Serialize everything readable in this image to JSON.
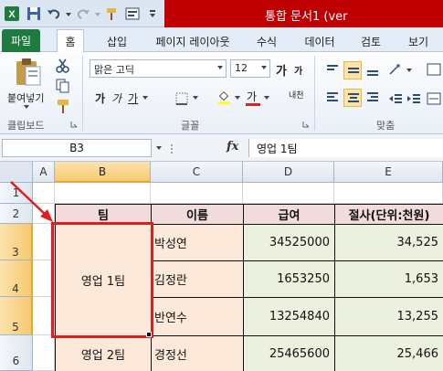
{
  "title": "통합 문서1 (ver",
  "tabs": [
    "파일",
    "홈",
    "삽입",
    "페이지 레이아웃",
    "수식",
    "데이터",
    "검토",
    "보기"
  ],
  "ribbon": {
    "paste_label": "붙여넣기",
    "clipboard_label": "클립보드",
    "font_name": "맑은 고딕",
    "font_size": "12",
    "font_group_label": "글꼴",
    "align_group_label": "맞춤",
    "bold": "가",
    "italic": "가",
    "underline": "가",
    "grow_font": "가",
    "shrink_font": "가",
    "font_color": "가",
    "phonetic": "내천"
  },
  "formula_bar": {
    "name_box": "B3",
    "fx": "fx",
    "content": "영업 1팀"
  },
  "grid": {
    "columns": [
      "A",
      "B",
      "C",
      "D",
      "E"
    ],
    "rows": [
      "1",
      "2",
      "3",
      "4",
      "5",
      "6"
    ],
    "headers": {
      "team": "팀",
      "name": "이름",
      "salary": "급여",
      "cut": "절사(단위:천원)"
    },
    "data": [
      {
        "team": "영업 1팀",
        "name": "박성연",
        "salary": "34525000",
        "cut": "34,525"
      },
      {
        "team": "",
        "name": "김정란",
        "salary": "1653250",
        "cut": "1,653"
      },
      {
        "team": "",
        "name": "반연수",
        "salary": "13254840",
        "cut": "13,255"
      },
      {
        "team": "영업 2팀",
        "name": "경정선",
        "salary": "25465600",
        "cut": "25,466"
      }
    ]
  },
  "colors": {
    "file_tab": "#1e7a3e",
    "title_red": "#c00000",
    "header_fill": "#f2dcdb",
    "text_fill": "#fde9d9",
    "number_fill": "#ebf1de",
    "highlight": "#e21d1d"
  }
}
